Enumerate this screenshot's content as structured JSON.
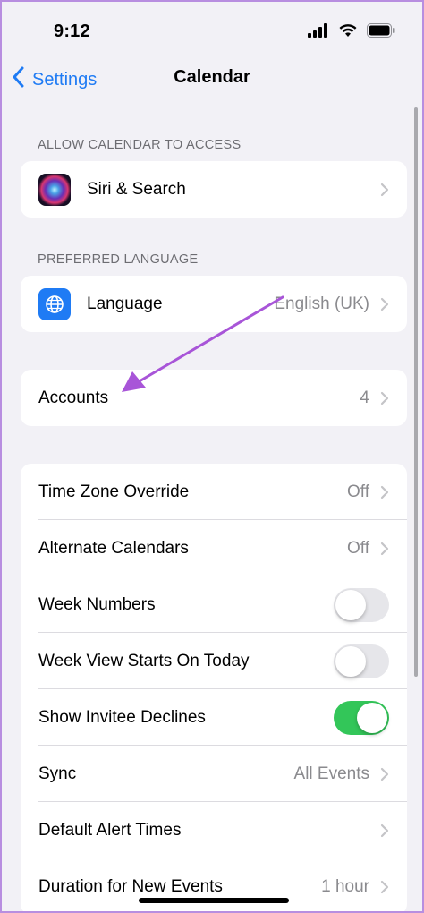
{
  "status_bar": {
    "time": "9:12"
  },
  "nav": {
    "back_label": "Settings",
    "title": "Calendar"
  },
  "sections": {
    "access": {
      "header": "ALLOW CALENDAR TO ACCESS",
      "siri": {
        "label": "Siri & Search",
        "icon": "siri-icon"
      }
    },
    "language": {
      "header": "PREFERRED LANGUAGE",
      "language": {
        "label": "Language",
        "value": "English (UK)",
        "icon": "globe-icon"
      }
    },
    "accounts": {
      "label": "Accounts",
      "value": "4"
    },
    "settings": {
      "time_zone_override": {
        "label": "Time Zone Override",
        "value": "Off"
      },
      "alternate_calendars": {
        "label": "Alternate Calendars",
        "value": "Off"
      },
      "week_numbers": {
        "label": "Week Numbers",
        "toggle_on": false
      },
      "week_view_starts_today": {
        "label": "Week View Starts On Today",
        "toggle_on": false
      },
      "show_invitee_declines": {
        "label": "Show Invitee Declines",
        "toggle_on": true
      },
      "sync": {
        "label": "Sync",
        "value": "All Events"
      },
      "default_alert_times": {
        "label": "Default Alert Times"
      },
      "duration_new_events": {
        "label": "Duration for New Events",
        "value": "1 hour"
      }
    }
  },
  "colors": {
    "accent": "#1f7bf4",
    "toggle_on": "#33c659",
    "annotation_arrow": "#a855d8",
    "border": "#b88ee0"
  }
}
